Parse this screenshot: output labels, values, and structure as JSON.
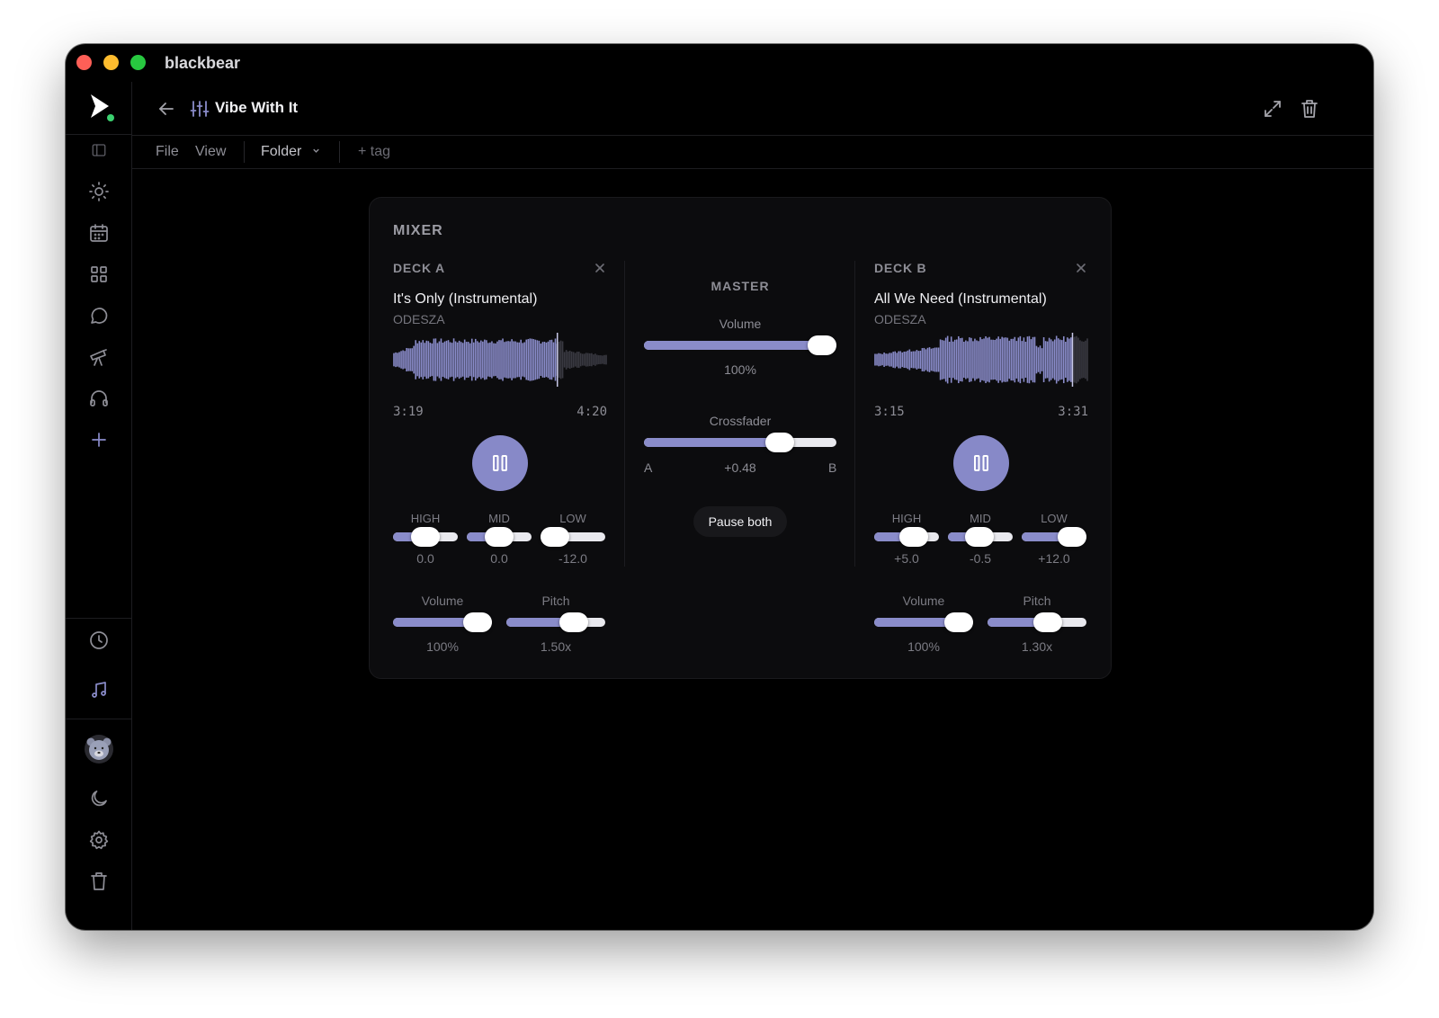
{
  "app": {
    "title": "blackbear"
  },
  "document": {
    "title": "Vibe With It"
  },
  "menu": {
    "file": "File",
    "view": "View",
    "folder": "Folder",
    "tag": "+ tag"
  },
  "mixer": {
    "title": "MIXER",
    "deck_a": {
      "label": "DECK A",
      "track": "It's Only (Instrumental)",
      "artist": "ODESZA",
      "elapsed": "3:19",
      "duration": "4:20",
      "progress": 0.77,
      "eq": [
        {
          "label": "HIGH",
          "value": "0.0",
          "level": 0.5
        },
        {
          "label": "MID",
          "value": "0.0",
          "level": 0.5
        },
        {
          "label": "LOW",
          "value": "-12.0",
          "level": 0.0
        }
      ],
      "volume": {
        "label": "Volume",
        "value": "100%",
        "level": 1.0
      },
      "pitch": {
        "label": "Pitch",
        "value": "1.50x",
        "level": 0.75
      }
    },
    "deck_b": {
      "label": "DECK B",
      "track": "All We Need (Instrumental)",
      "artist": "ODESZA",
      "elapsed": "3:15",
      "duration": "3:31",
      "progress": 0.93,
      "eq": [
        {
          "label": "HIGH",
          "value": "+5.0",
          "level": 0.71
        },
        {
          "label": "MID",
          "value": "-0.5",
          "level": 0.48
        },
        {
          "label": "LOW",
          "value": "+12.0",
          "level": 1.0
        }
      ],
      "volume": {
        "label": "Volume",
        "value": "100%",
        "level": 1.0
      },
      "pitch": {
        "label": "Pitch",
        "value": "1.30x",
        "level": 0.65
      }
    },
    "master": {
      "title": "MASTER",
      "volume_label": "Volume",
      "volume_value": "100%",
      "volume_level": 1.0,
      "crossfader_label": "Crossfader",
      "crossfader_value": "+0.48",
      "crossfader_level": 0.74,
      "side_a": "A",
      "side_b": "B",
      "pause_both": "Pause both"
    }
  },
  "colors": {
    "accent": "#8a8cca",
    "background": "#000000",
    "panel": "#0c0c0e"
  }
}
